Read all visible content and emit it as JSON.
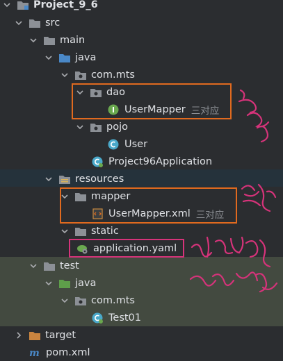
{
  "tree": {
    "project": {
      "label": "Project_9_6"
    },
    "src": {
      "label": "src"
    },
    "main": {
      "label": "main"
    },
    "java_main": {
      "label": "java"
    },
    "package_main": {
      "label": "com.mts"
    },
    "dao": {
      "label": "dao"
    },
    "user_mapper": {
      "label": "UserMapper",
      "hint": "三对应"
    },
    "pojo": {
      "label": "pojo"
    },
    "user": {
      "label": "User"
    },
    "application_class": {
      "label": "Project96Application"
    },
    "resources": {
      "label": "resources"
    },
    "mapper": {
      "label": "mapper"
    },
    "user_mapper_xml": {
      "label": "UserMapper.xml",
      "hint": "三对应"
    },
    "static": {
      "label": "static"
    },
    "application_yaml": {
      "label": "application.yaml"
    },
    "test": {
      "label": "test"
    },
    "java_test": {
      "label": "java"
    },
    "package_test": {
      "label": "com.mts"
    },
    "test_class": {
      "label": "Test01"
    },
    "target": {
      "label": "target"
    },
    "pom": {
      "label": "pom.xml"
    }
  },
  "colors": {
    "background": "#2b2d30",
    "selection": "#25323b",
    "test_band": "#434a40",
    "annotation_orange": "#e06a1f",
    "annotation_pink": "#d6337a",
    "folder": "#8c9096",
    "test_folder": "#5e9e4a",
    "class_icon": "#4aa8c9",
    "interface_icon": "#6aa84f"
  }
}
